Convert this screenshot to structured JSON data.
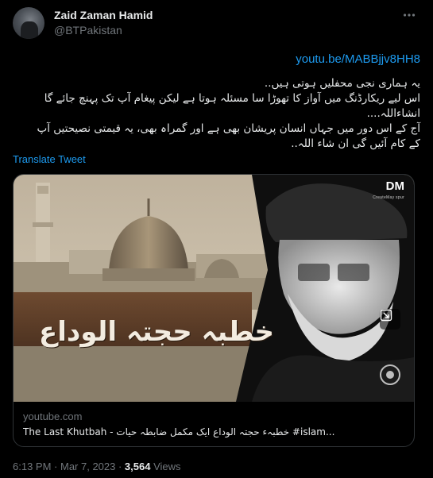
{
  "author": {
    "name": "Zaid Zaman Hamid",
    "handle": "@BTPakistan",
    "avatar_icon": "avatar-photo"
  },
  "more_icon": "more-horizontal-icon",
  "tweet": {
    "link": "youtu.be/MABBjjv8HH8",
    "lines": [
      "یہ ہماری نجی محفلیں ہوتی ہیں..",
      "اس لیے ریکارڈنگ میں آواز کا تھوڑا سا مسئلہ ہوتا ہے لیکن پیغام آپ تک پہنچ جائے گا",
      "انشاءاللہ....",
      "آج کے اس دور میں جہاں انسان پریشان بھی ہے اور گمراہ بھی، یہ قیمتی نصیحتیں آپ",
      "کے کام آئیں گی ان شاء اللہ.."
    ],
    "translate_label": "Translate Tweet"
  },
  "card": {
    "thumbnail_title": "خطبہ حجتہ الوداع",
    "logo_text": "DM",
    "logo_sub": "CreateMay spur",
    "expand_icon": "expand-media-icon",
    "domain": "youtube.com",
    "title": "The Last Khutbah - خطبہء حجتہ الوداع ایک مکمل ضابطہ حیات #islam..."
  },
  "meta": {
    "time": "6:13 PM",
    "separator": " · ",
    "date": "Mar 7, 2023",
    "views_count": "3,564",
    "views_label": " Views"
  },
  "colors": {
    "background": "#000000",
    "text": "#e7e9ea",
    "muted": "#71767b",
    "accent": "#1d9bf0",
    "border": "#2f3336"
  }
}
